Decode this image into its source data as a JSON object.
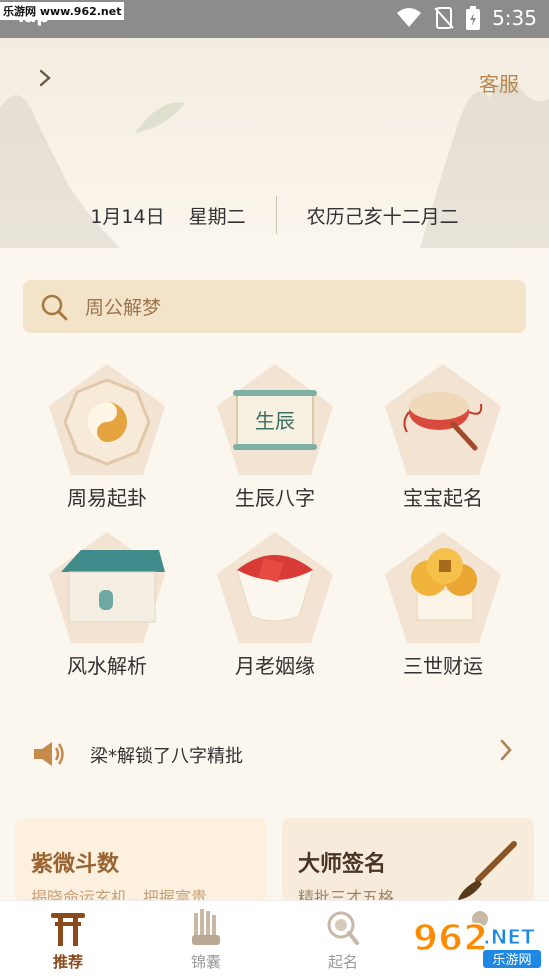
{
  "status_bar": {
    "left_text": "lap",
    "time": "5:35",
    "watermark": "乐游网 www.962.net"
  },
  "header": {
    "back_icon": "chevron-right-icon",
    "service_label": "客服"
  },
  "date": {
    "solar": "1月14日",
    "weekday": "星期二",
    "lunar": "农历己亥十二月二"
  },
  "search": {
    "placeholder": "周公解梦"
  },
  "features": [
    {
      "label": "周易起卦",
      "icon": "bagua-icon"
    },
    {
      "label": "生辰八字",
      "icon": "scroll-icon"
    },
    {
      "label": "宝宝起名",
      "icon": "rattle-drum-icon"
    },
    {
      "label": "风水解析",
      "icon": "house-icon"
    },
    {
      "label": "月老姻缘",
      "icon": "red-thread-icon"
    },
    {
      "label": "三世财运",
      "icon": "coins-icon"
    }
  ],
  "scroll_label": "生辰",
  "notice": {
    "text": "梁*解锁了八字精批"
  },
  "cards": [
    {
      "title": "紫微斗数",
      "subtitle": "揭晓命运玄机，把握富贵"
    },
    {
      "title": "大师签名",
      "subtitle": "精批三才五格"
    }
  ],
  "bottom_nav": [
    {
      "label": "推荐",
      "active": true
    },
    {
      "label": "锦囊",
      "active": false
    },
    {
      "label": "起名",
      "active": false
    },
    {
      "label": "",
      "active": false
    }
  ],
  "watermark_bottom": {
    "big": "962",
    "net": ".NET",
    "cn": "乐游网"
  },
  "colors": {
    "accent": "#b7884e",
    "search_bg": "#f3e3c9",
    "active_tab": "#8a4a1c"
  }
}
